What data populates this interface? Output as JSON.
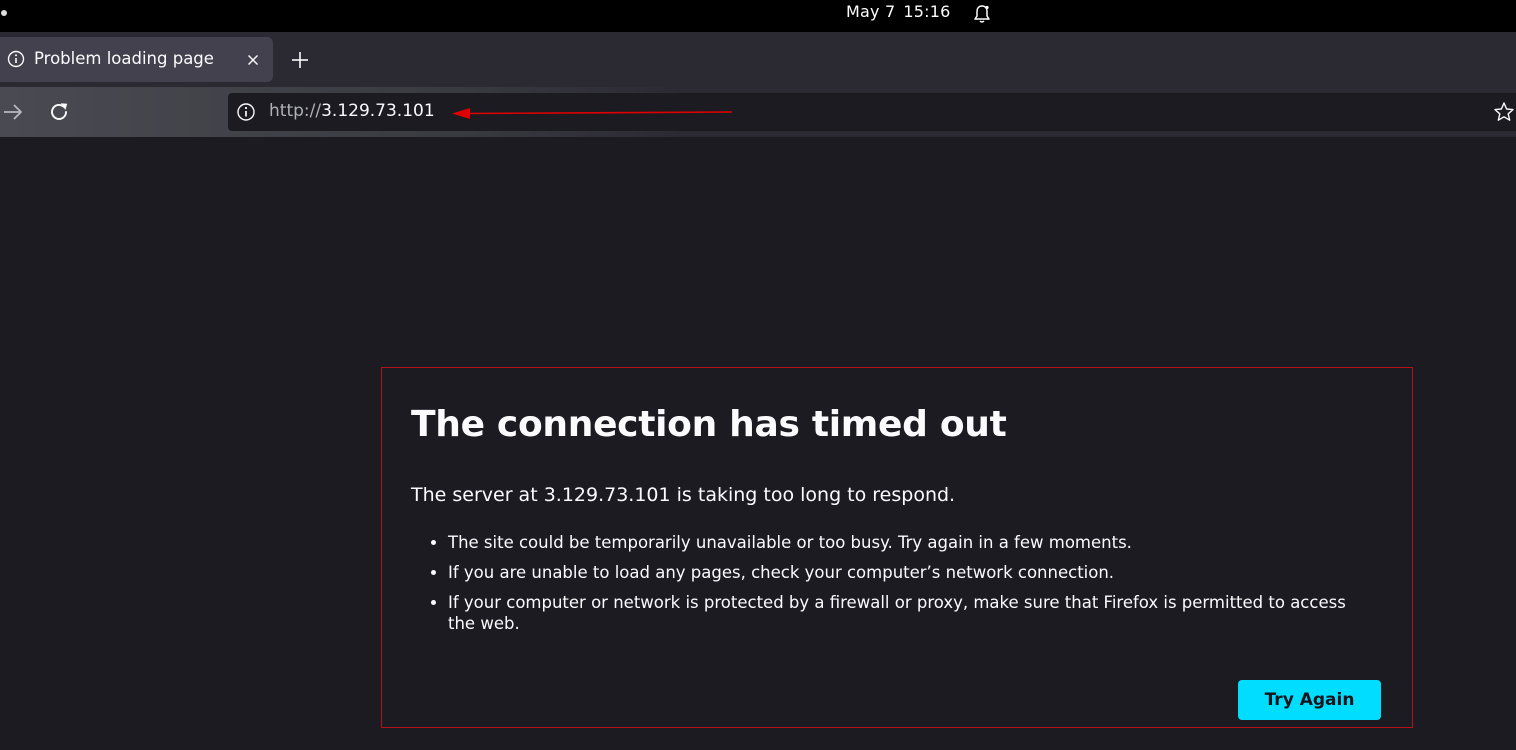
{
  "system_bar": {
    "date": "May 7",
    "time": "15:16"
  },
  "tabs": [
    {
      "title": "Problem loading page",
      "icon": "info-icon",
      "active": true
    }
  ],
  "navigation": {
    "url_scheme": "http://",
    "url_host": "3.129.73.101"
  },
  "error_page": {
    "title": "The connection has timed out",
    "description": "The server at 3.129.73.101 is taking too long to respond.",
    "suggestions": [
      "The site could be temporarily unavailable or too busy. Try again in a few moments.",
      "If you are unable to load any pages, check your computer’s network connection.",
      "If your computer or network is protected by a firewall or proxy, make sure that Firefox is permitted to access the web."
    ],
    "try_again_label": "Try Again"
  },
  "colors": {
    "page_background": "#1c1b22",
    "error_border": "#b3121b",
    "accent_button": "#00ddff",
    "annotation_arrow": "#e00000"
  }
}
